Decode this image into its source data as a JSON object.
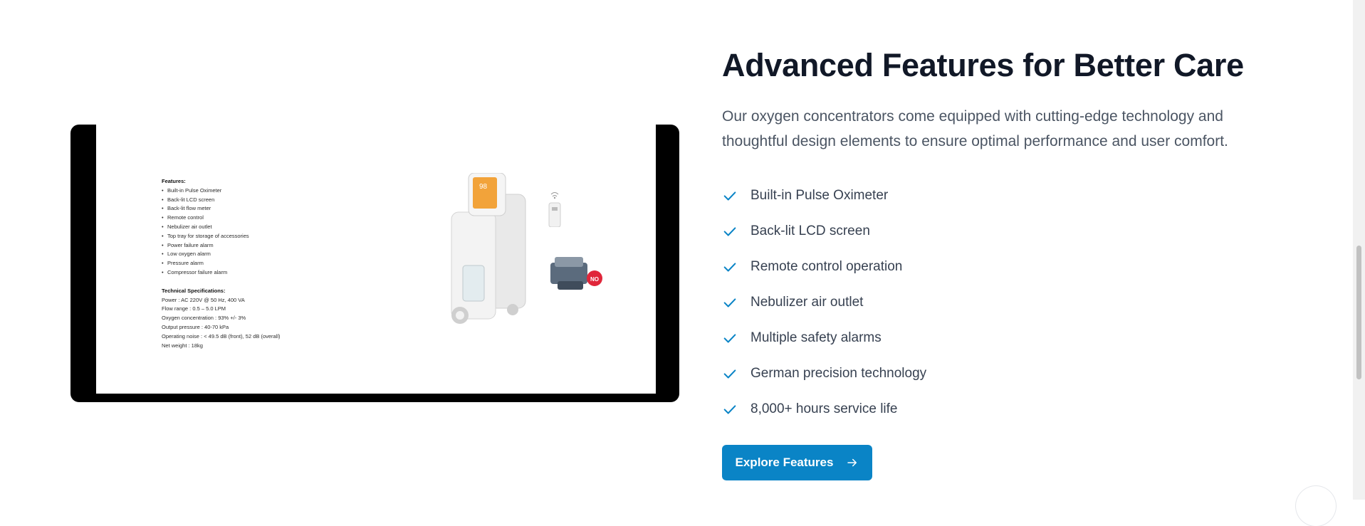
{
  "media": {
    "spec_sheet": {
      "features_heading": "Features:",
      "features": [
        "Built-in Pulse Oximeter",
        "Back-lit LCD screen",
        "Back-lit flow meter",
        "Remote control",
        "Nebulizer air outlet",
        "Top tray for storage of accessories",
        "Power failure alarm",
        "Low oxygen alarm",
        "Pressure alarm",
        "Compressor failure alarm"
      ],
      "tech_heading": "Technical Specifications:",
      "tech_specs": [
        "Power : AC 220V @ 50 Hz, 400 VA",
        "Flow range : 0.5 – 5.0 LPM",
        "Oxygen concentration : 93% +/- 3%",
        "Output pressure : 40-70 kPa",
        "Operating noise : < 49.5 dB (front), 52 dB (overall)",
        "Net weight : 18kg"
      ]
    },
    "badge_text": "NO"
  },
  "section": {
    "title": "Advanced Features for Better Care",
    "description": "Our oxygen concentrators come equipped with cutting-edge technology and thoughtful design elements to ensure optimal performance and user comfort.",
    "features": [
      "Built-in Pulse Oximeter",
      "Back-lit LCD screen",
      "Remote control operation",
      "Nebulizer air outlet",
      "Multiple safety alarms",
      "German precision technology",
      "8,000+ hours service life"
    ],
    "cta_label": "Explore Features"
  },
  "colors": {
    "accent": "#0a84c6",
    "heading": "#111827",
    "body_text": "#4b5563",
    "check": "#0a84c6"
  },
  "icons": {
    "feature_check": "check-icon",
    "cta_arrow": "arrow-right-icon",
    "remote_signal": "wifi-icon"
  }
}
